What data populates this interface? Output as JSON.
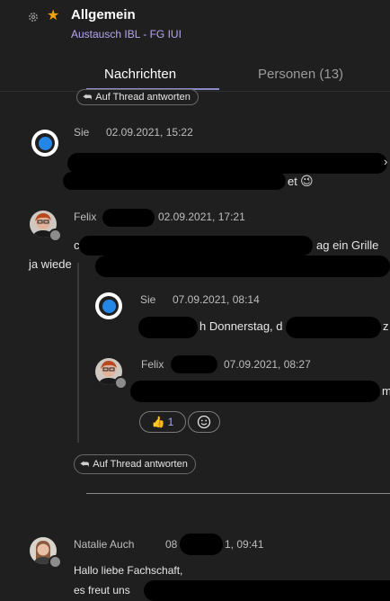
{
  "header": {
    "gear_icon": "gear-icon",
    "star_icon": "star-icon",
    "title": "Allgemein",
    "subtitle": "Austausch IBL - FG IUI",
    "tabs": [
      {
        "label": "Nachrichten",
        "active": true
      },
      {
        "label": "Personen (13)",
        "active": false
      }
    ]
  },
  "reply_label": "Auf Thread antworten",
  "messages": [
    {
      "author": "Sie",
      "timestamp": "02.09.2021, 15:22",
      "fragments": [
        "›",
        "et"
      ],
      "emoji": "😉"
    },
    {
      "author": "Felix",
      "timestamp": "02.09.2021, 17:21",
      "fragments": [
        "c",
        "ag ein Grille",
        "ja wiede"
      ],
      "replies": [
        {
          "author": "Sie",
          "timestamp": "07.09.2021, 08:14",
          "fragments": [
            "h Donnerstag, d",
            "z"
          ]
        },
        {
          "author": "Felix",
          "timestamp": "07.09.2021, 08:27",
          "fragments": [
            "m"
          ],
          "reactions": [
            {
              "emoji": "👍",
              "count": "1"
            }
          ]
        }
      ]
    },
    {
      "author": "Natalie Auch",
      "timestamp_start": "08",
      "timestamp_end": "1, 09:41",
      "lines": [
        "Hallo liebe Fachschaft,",
        "es freut uns"
      ]
    }
  ],
  "colors": {
    "background": "#1f1f1f",
    "accent": "#8b8cc7",
    "subtitle": "#b7a6f3",
    "star": "#f0a30a",
    "bubble": "#2487e8"
  }
}
